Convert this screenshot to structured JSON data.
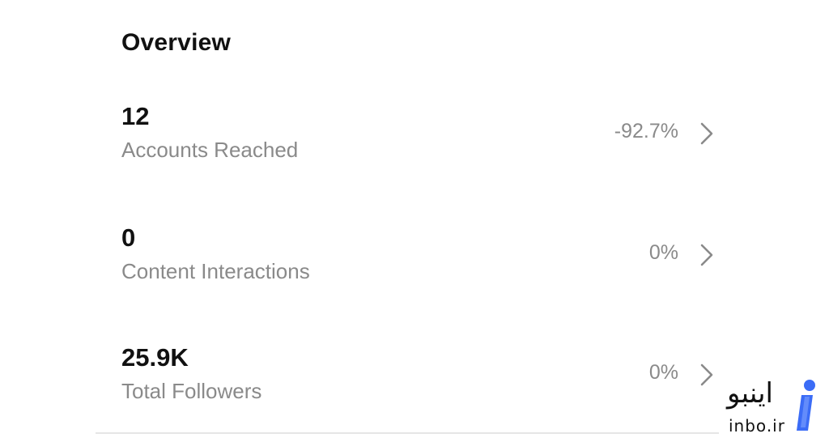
{
  "overview": {
    "title": "Overview"
  },
  "metrics": [
    {
      "value": "12",
      "label": "Accounts Reached",
      "change": "-92.7%"
    },
    {
      "value": "0",
      "label": "Content Interactions",
      "change": "0%"
    },
    {
      "value": "25.9K",
      "label": "Total Followers",
      "change": "0%"
    }
  ],
  "watermark": {
    "persian_text": "اینبو",
    "latin_text": "inbo.ir",
    "accent_color": "#3b6cf6",
    "dot_color": "#3b6cf6"
  },
  "icons": {
    "row_chevron": "chevron-right-icon",
    "logo": "inbo-logo-icon"
  }
}
